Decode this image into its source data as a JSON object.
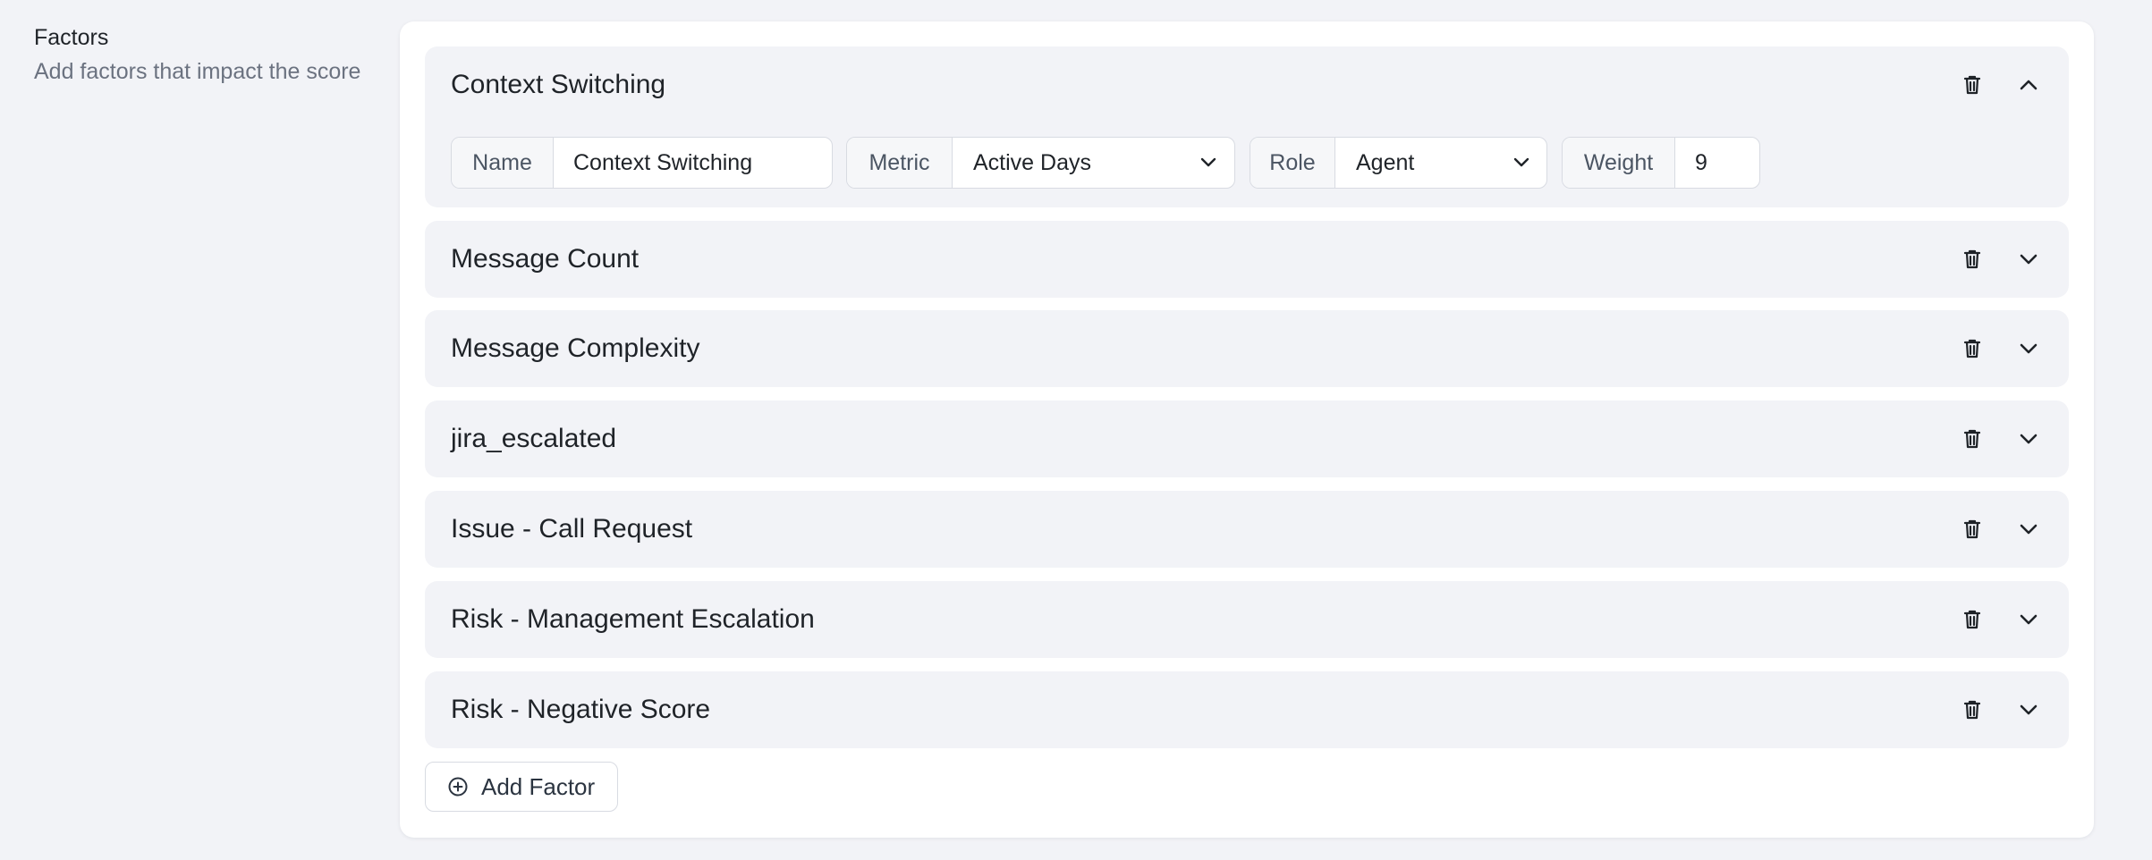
{
  "section": {
    "title": "Factors",
    "description": "Add factors that impact the score"
  },
  "factors": [
    {
      "title": "Context Switching",
      "expanded": true,
      "fields": {
        "name_label": "Name",
        "name_value": "Context Switching",
        "metric_label": "Metric",
        "metric_value": "Active Days",
        "role_label": "Role",
        "role_value": "Agent",
        "weight_label": "Weight",
        "weight_value": "9"
      }
    },
    {
      "title": "Message Count",
      "expanded": false
    },
    {
      "title": "Message Complexity",
      "expanded": false
    },
    {
      "title": "jira_escalated",
      "expanded": false
    },
    {
      "title": "Issue - Call Request",
      "expanded": false
    },
    {
      "title": "Risk - Management Escalation",
      "expanded": false
    },
    {
      "title": "Risk - Negative Score",
      "expanded": false
    }
  ],
  "actions": {
    "add_factor_label": "Add Factor"
  },
  "icons": {
    "delete": "trash-icon",
    "expand": "chevron-down-icon",
    "collapse": "chevron-up-icon",
    "add": "plus-circle-icon",
    "select": "chevron-down-icon"
  }
}
